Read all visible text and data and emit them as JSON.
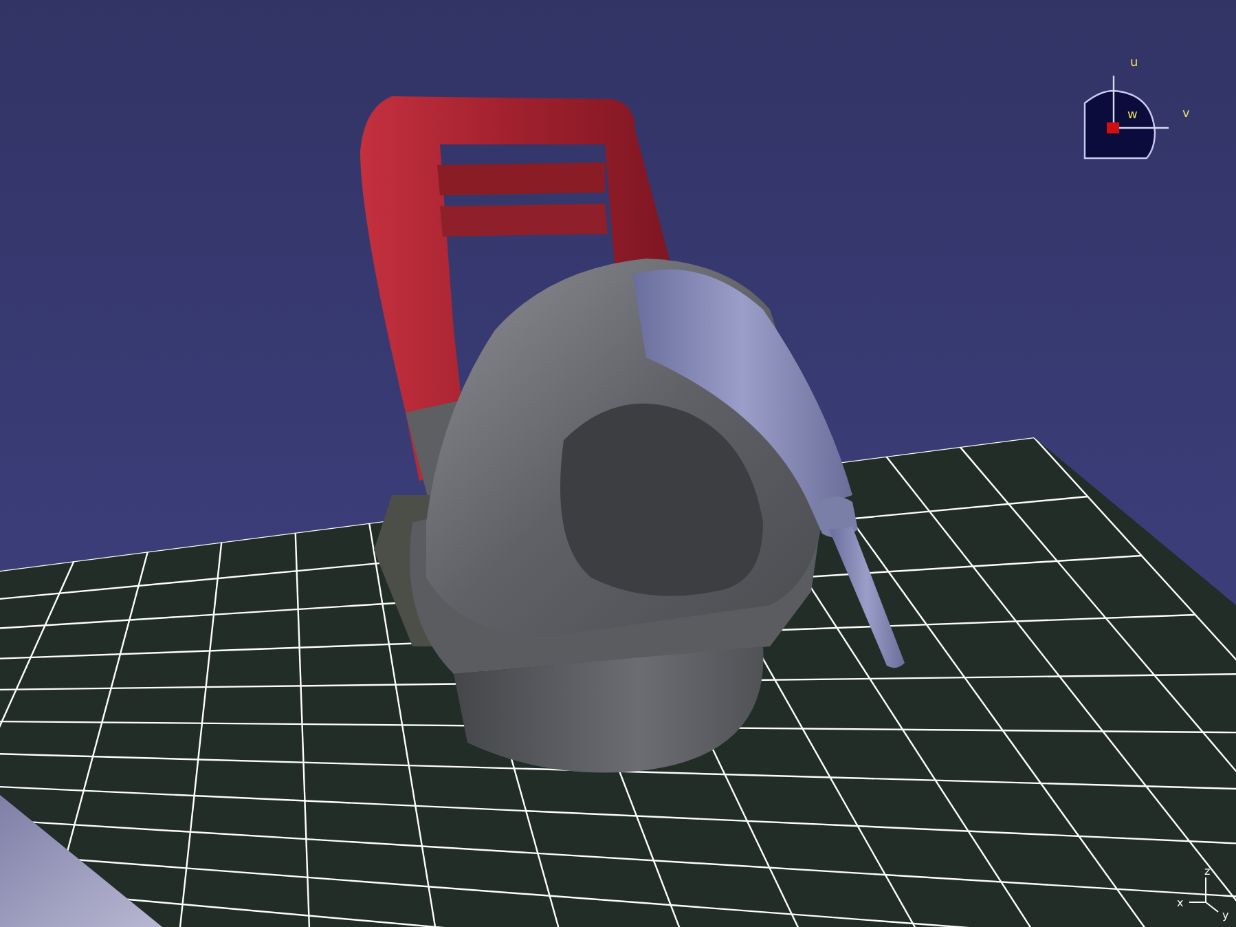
{
  "viewport": {
    "compass": {
      "labels": [
        "u",
        "v",
        "w"
      ]
    },
    "axis_triad": {
      "labels": [
        "z",
        "x",
        "y"
      ]
    }
  }
}
